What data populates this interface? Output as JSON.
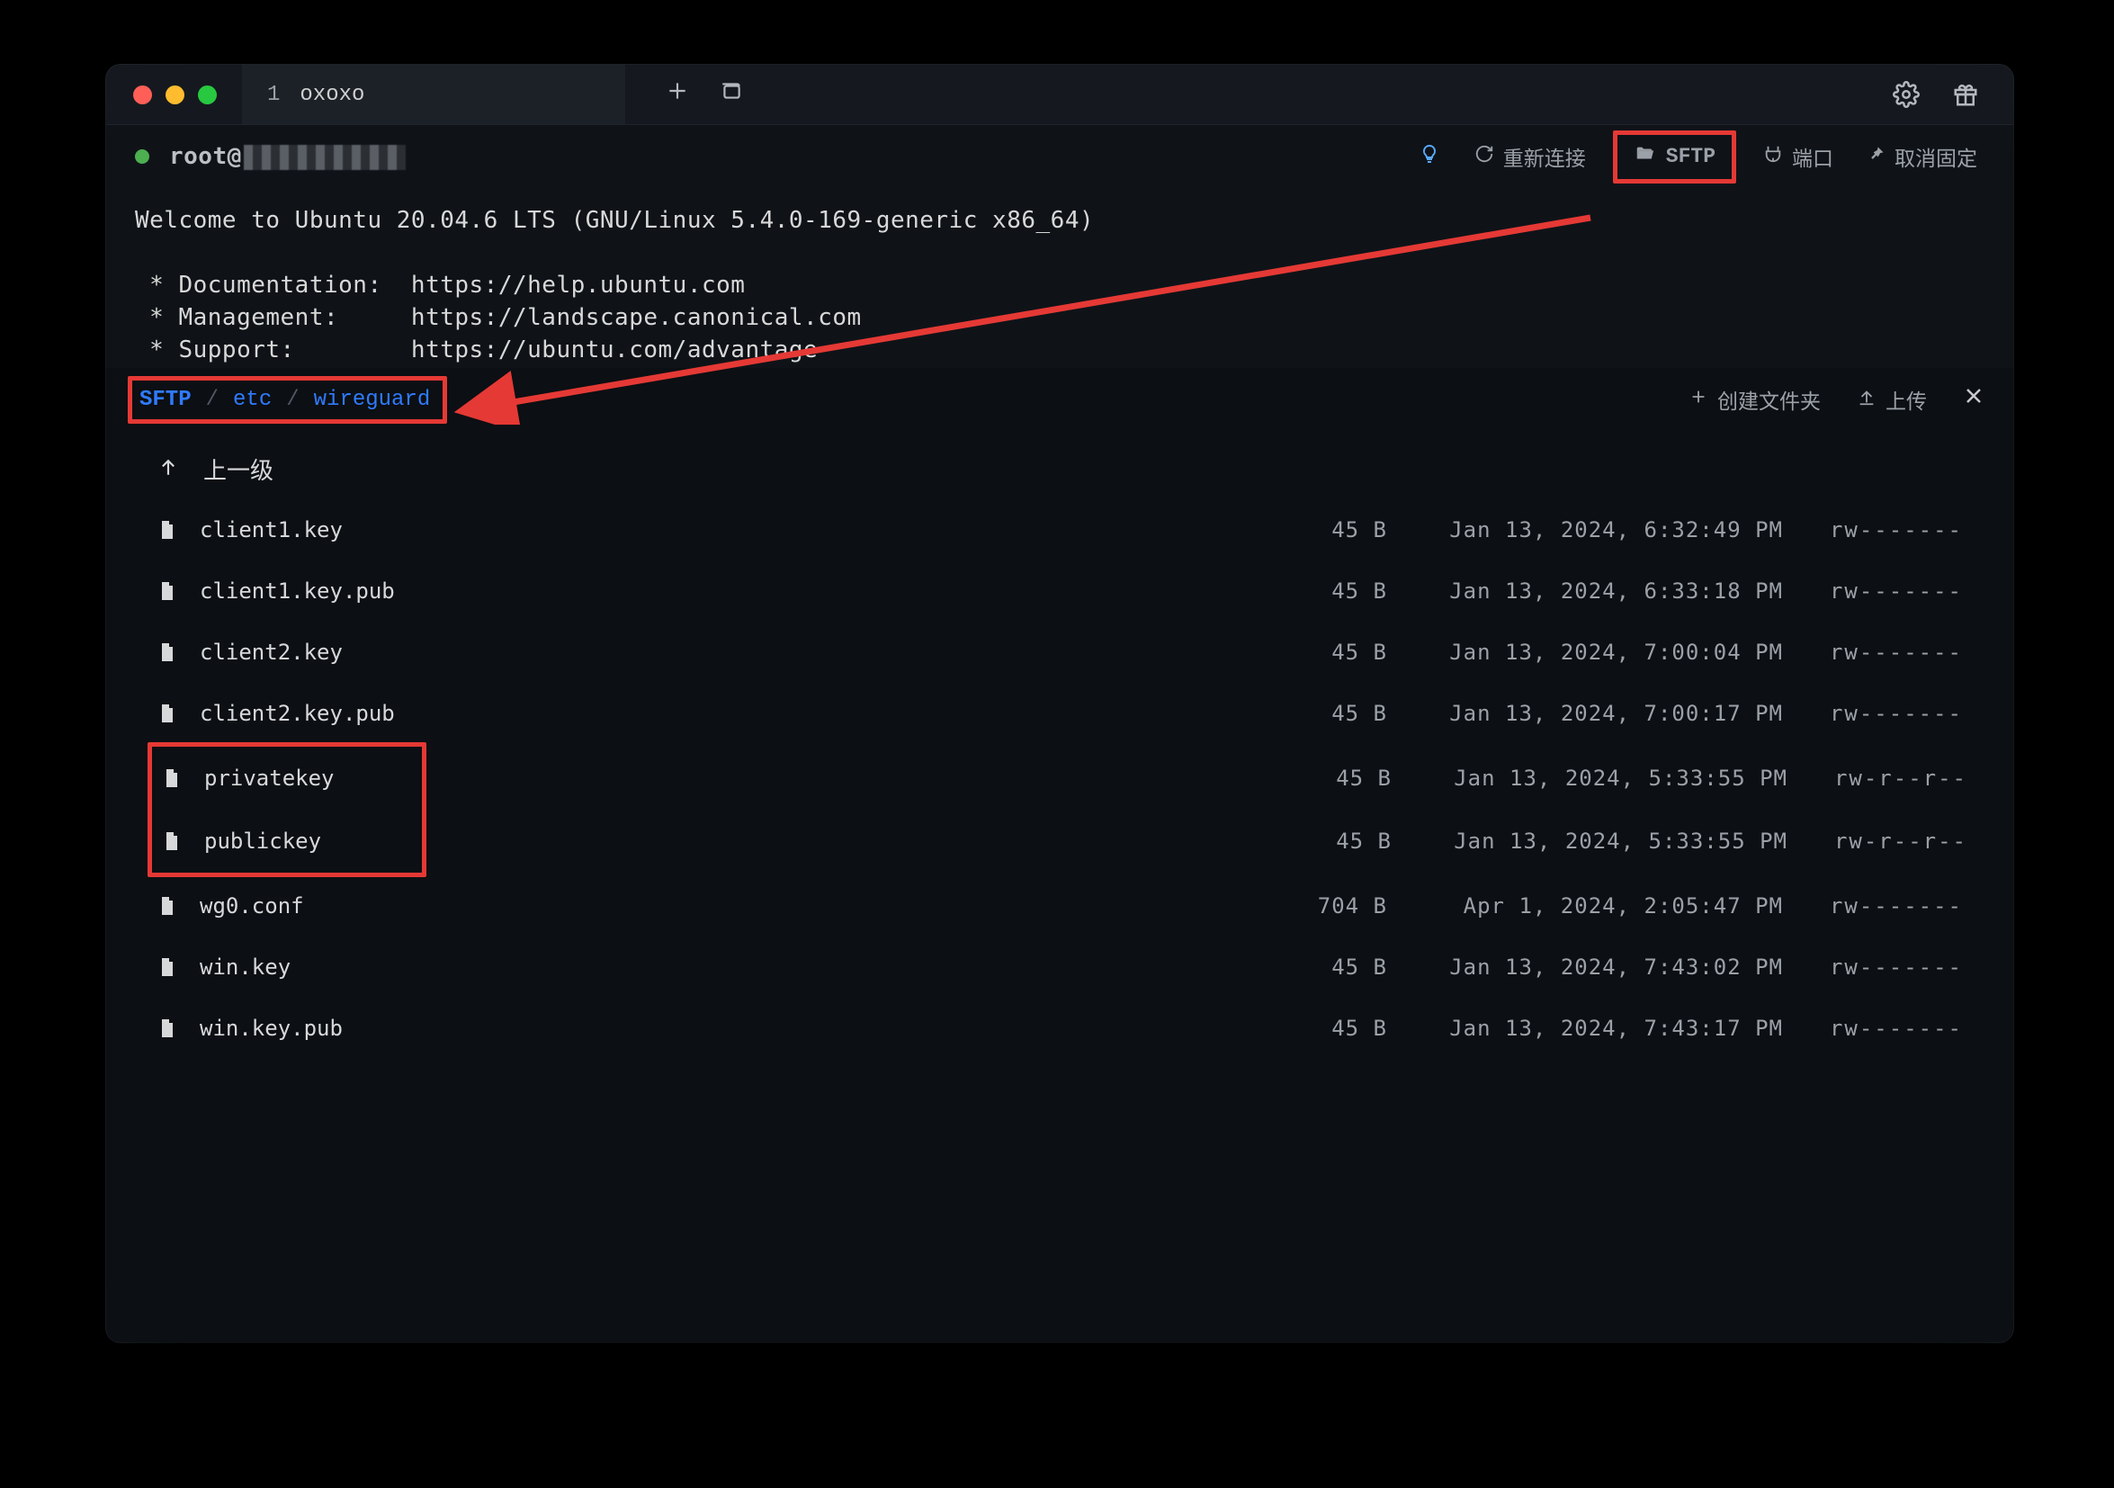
{
  "titlebar": {
    "tab_number": "1",
    "tab_title": "oxoxo"
  },
  "session": {
    "user_host_prefix": "root@",
    "hint_label": "",
    "reconnect_label": "重新连接",
    "sftp_label": "SFTP",
    "port_label": "端口",
    "unpin_label": "取消固定"
  },
  "terminal_lines": [
    "Welcome to Ubuntu 20.04.6 LTS (GNU/Linux 5.4.0-169-generic x86_64)",
    "",
    " * Documentation:  https://help.ubuntu.com",
    " * Management:     https://landscape.canonical.com",
    " * Support:        https://ubuntu.com/advantage"
  ],
  "sftp": {
    "crumbs": [
      "SFTP",
      "etc",
      "wireguard"
    ],
    "create_folder_label": "创建文件夹",
    "upload_label": "上传",
    "parent_label": "上一级"
  },
  "files": [
    {
      "name": "client1.key",
      "size": "45 B",
      "date": "Jan 13, 2024, 6:32:49 PM",
      "perm": "rw-------"
    },
    {
      "name": "client1.key.pub",
      "size": "45 B",
      "date": "Jan 13, 2024, 6:33:18 PM",
      "perm": "rw-------"
    },
    {
      "name": "client2.key",
      "size": "45 B",
      "date": "Jan 13, 2024, 7:00:04 PM",
      "perm": "rw-------"
    },
    {
      "name": "client2.key.pub",
      "size": "45 B",
      "date": "Jan 13, 2024, 7:00:17 PM",
      "perm": "rw-------"
    },
    {
      "name": "privatekey",
      "size": "45 B",
      "date": "Jan 13, 2024, 5:33:55 PM",
      "perm": "rw-r--r--"
    },
    {
      "name": "publickey",
      "size": "45 B",
      "date": "Jan 13, 2024, 5:33:55 PM",
      "perm": "rw-r--r--"
    },
    {
      "name": "wg0.conf",
      "size": "704 B",
      "date": "Apr 1, 2024, 2:05:47 PM",
      "perm": "rw-------"
    },
    {
      "name": "win.key",
      "size": "45 B",
      "date": "Jan 13, 2024, 7:43:02 PM",
      "perm": "rw-------"
    },
    {
      "name": "win.key.pub",
      "size": "45 B",
      "date": "Jan 13, 2024, 7:43:17 PM",
      "perm": "rw-------"
    }
  ],
  "annotations": {
    "highlight_sftp_button": true,
    "highlight_breadcrumb": true,
    "highlight_file_rows": [
      4,
      5
    ],
    "arrow_from_sftp_to_breadcrumb": true
  }
}
